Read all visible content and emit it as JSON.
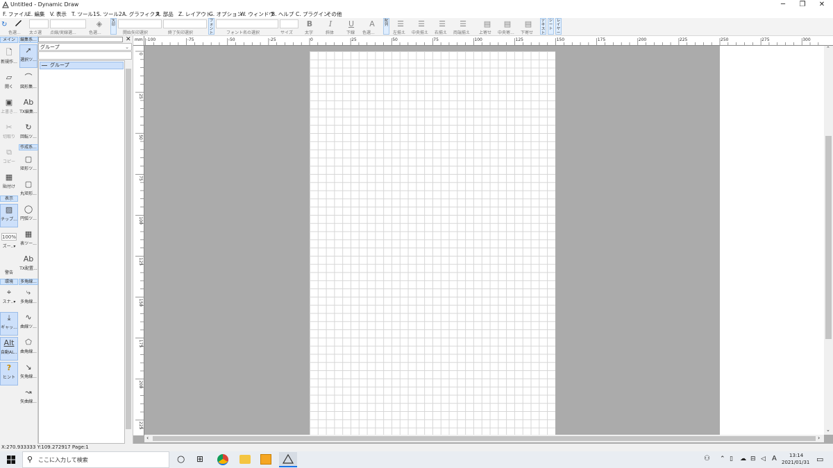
{
  "window": {
    "title": "Untitled - Dynamic Draw",
    "controls": [
      "─",
      "❐",
      "✕"
    ]
  },
  "menu": [
    "F. ファイル",
    "E. 編集",
    "V. 表示",
    "T. ツール1",
    "S. ツール2",
    "A. グラフィクス",
    "R. 部品",
    "Z. レイアウト",
    "G. オプション",
    "W. ウィンドウ",
    "B. ヘルプ",
    "C. プラグイン",
    "その他"
  ],
  "toolbar": {
    "color_label": "色選...",
    "thickness_label": "太さ選",
    "dash_label": "点線/実線選...",
    "fill_label": "色選...",
    "vlabel_arrow": "矢印",
    "start_arrow_label": "開始矢印選択",
    "end_arrow_label": "終了矢印選択",
    "vlabel_font": "フォント",
    "font_name_label": "フォント名の選択",
    "size_label": "サイズ",
    "bold_label": "太字",
    "italic_label": "斜体",
    "underline_label": "下線",
    "text_color_label": "色選...",
    "vlabel_align": "配列",
    "align_left_label": "左揃え",
    "align_center_label": "中央揃え",
    "align_right_label": "右揃え",
    "justify_label": "両端揃え",
    "valign_top_label": "上寄せ",
    "valign_center_label": "中央寄...",
    "valign_bottom_label": "下寄せ",
    "vlabel_text": "テキスト",
    "vlabel_sheet": "シート",
    "vlabel_layer": "レイヤー"
  },
  "left_tools": {
    "tab_main": "メイン",
    "tab_view": "表示",
    "tab_env": "環境",
    "new": "新規作...",
    "open": "開く",
    "save": "上書き...",
    "cut": "切取り",
    "copy": "コピー",
    "paste": "貼付け",
    "chip": "チップ...",
    "zoom_value": "100%",
    "zoom": "ズー..▾",
    "warning": "警告",
    "snap": "スナ..▾",
    "gap": "ギャッ...",
    "auto_align": "自動AL...",
    "hint": "ヒント"
  },
  "drawing_tools": {
    "tab_edit": "編集系...",
    "tab_create": "作成系...",
    "tab_polygon": "多角線...",
    "select": "選択ツ...",
    "shape_edit": "図形集...",
    "text_edit": "TX編集...",
    "rotate": "回転ツ...",
    "rect": "矩形ツ...",
    "round_rect": "丸矩形...",
    "ellipse": "円弧ツ...",
    "table": "表ツー...",
    "text_place": "TX配置...",
    "polyline": "多角線...",
    "curve": "曲線ツ...",
    "polygon_curve": "曲角線...",
    "arrow_line": "矢角線...",
    "arrow_curve": "矢曲線..."
  },
  "tree": {
    "dropdown_value": "グループ",
    "items": [
      "グループ"
    ]
  },
  "ruler": {
    "unit": "mm",
    "h_ticks": [
      "-100",
      "-75",
      "-50",
      "-25",
      "0",
      "25",
      "50",
      "75",
      "100",
      "125",
      "150",
      "175",
      "200",
      "225",
      "250",
      "275",
      "300"
    ],
    "v_ticks": [
      "0",
      "25",
      "50",
      "75",
      "100",
      "125",
      "150",
      "175",
      "200",
      "225"
    ]
  },
  "status": {
    "coords": "X:270.933333 Y:109.272917 Page:1"
  },
  "taskbar": {
    "search_placeholder": "ここに入力して検索",
    "time": "13:14",
    "date": "2021/01/31",
    "ime": "A"
  }
}
